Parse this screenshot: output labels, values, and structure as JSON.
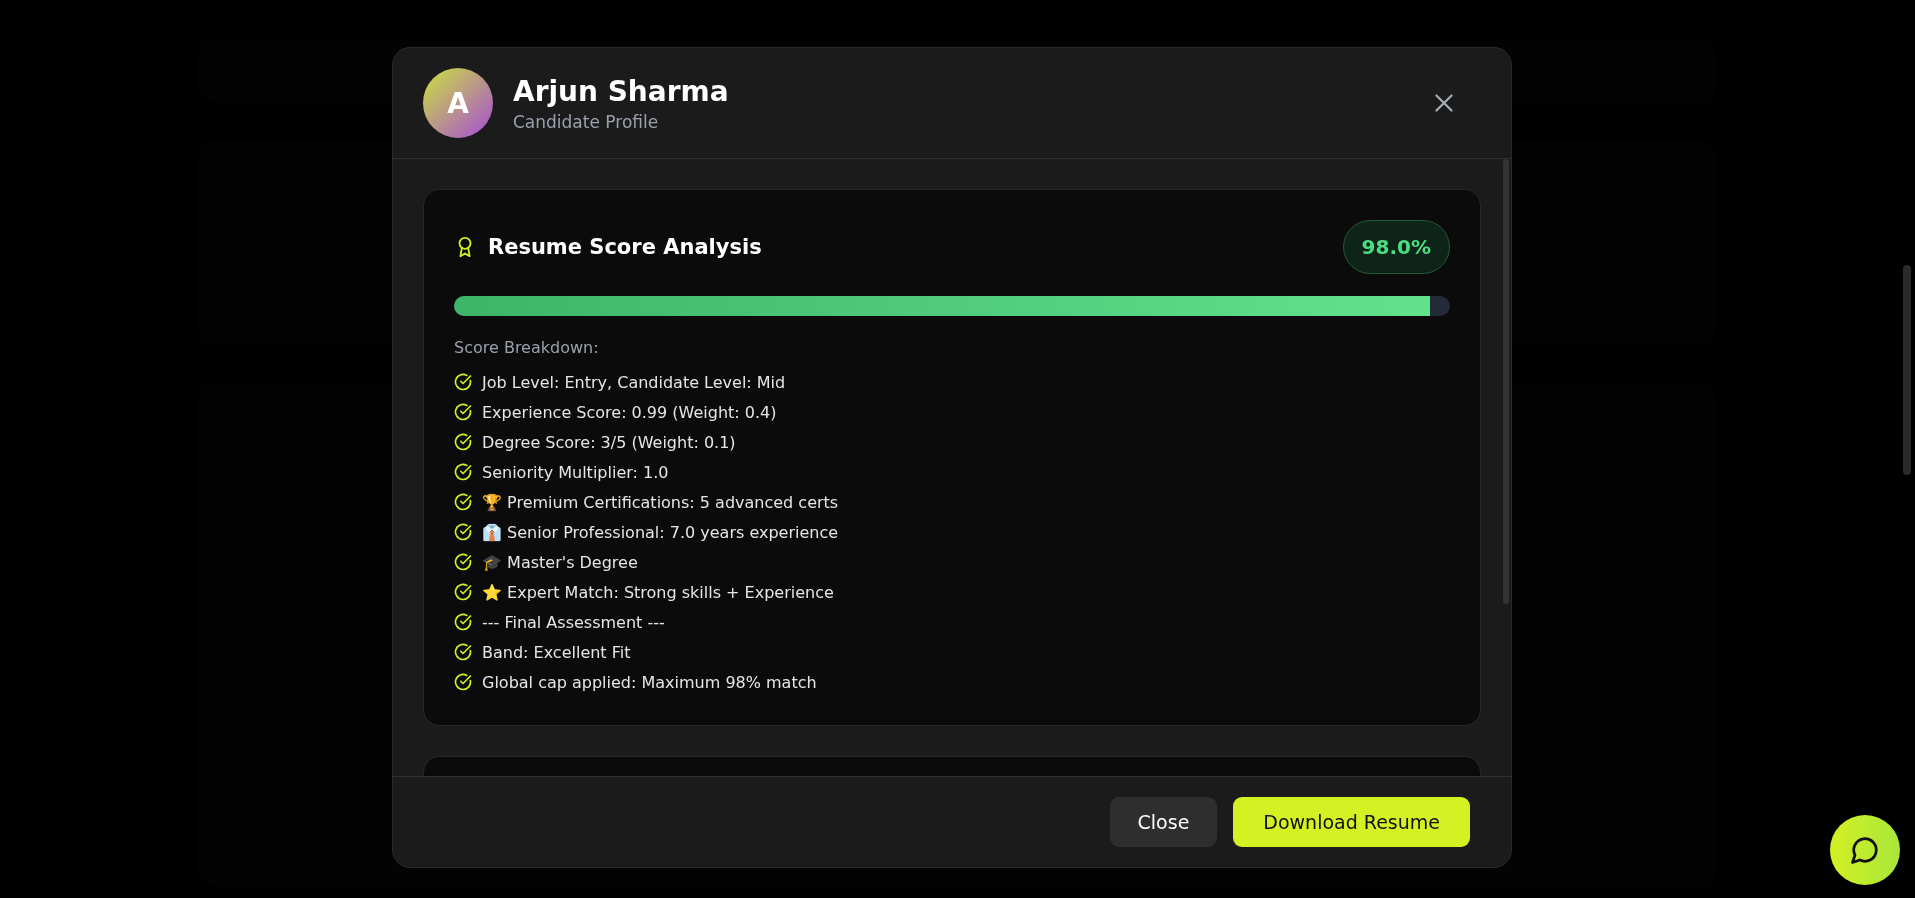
{
  "modal": {
    "avatar_letter": "A",
    "name": "Arjun Sharma",
    "subtitle": "Candidate Profile",
    "score_card": {
      "title": "Resume Score Analysis",
      "score": "98.0%",
      "level": 0.98,
      "breakdown_label": "Score Breakdown:",
      "items": [
        "Job Level: Entry, Candidate Level: Mid",
        "Experience Score: 0.99 (Weight: 0.4)",
        "Degree Score: 3/5 (Weight: 0.1)",
        "Seniority Multiplier: 1.0",
        "🏆 Premium Certifications: 5 advanced certs",
        "👔 Senior Professional: 7.0 years experience",
        "🎓 Master's Degree",
        "⭐ Expert Match: Strong skills + Experience",
        "--- Final Assessment ---",
        "Band: Excellent Fit",
        "Global cap applied: Maximum 98% match"
      ]
    },
    "buttons": [
      {
        "label": "Close",
        "kind": "secondary"
      },
      {
        "label": "Download Resume",
        "kind": "primary"
      }
    ]
  }
}
